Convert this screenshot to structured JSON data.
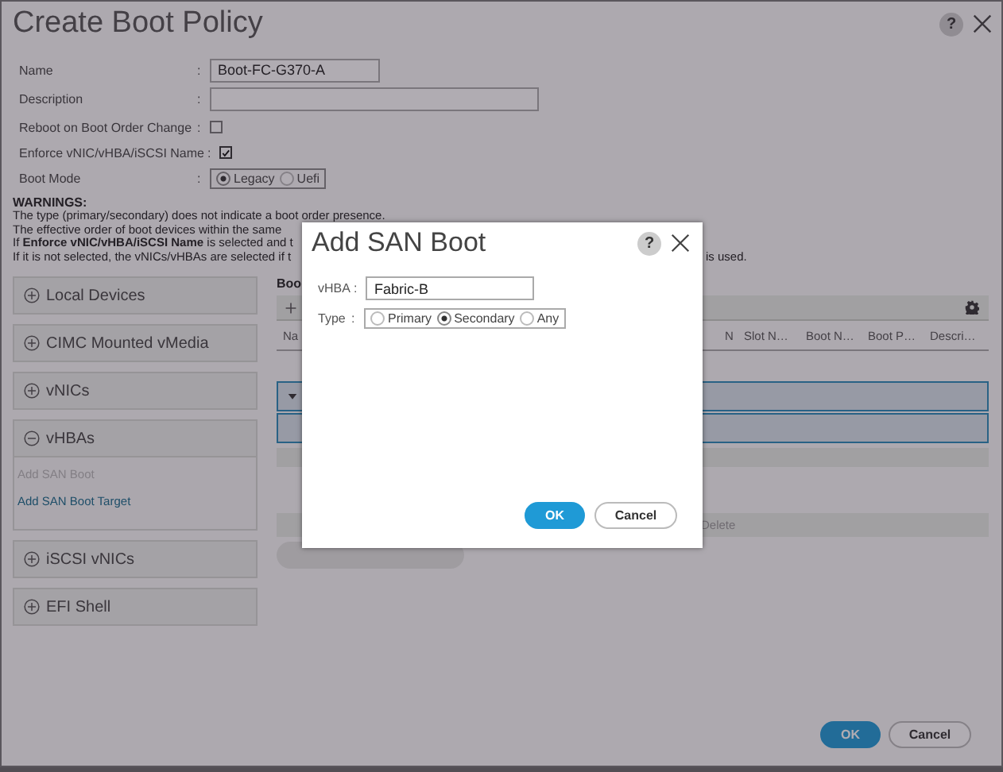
{
  "window": {
    "title": "Create Boot Policy",
    "help": "?"
  },
  "form": [
    {
      "kind": "text",
      "label": "Name",
      "colon": ":",
      "value": "Boot-FC-G370-A"
    },
    {
      "kind": "text",
      "label": "Description",
      "colon": ":"
    },
    {
      "kind": "checkbox",
      "label": "Reboot on Boot Order Change",
      "colon": ":",
      "checked": false
    },
    {
      "kind": "checkbox",
      "label": "Enforce vNIC/vHBA/iSCSI Name",
      "colon": ":",
      "checked": true
    },
    {
      "kind": "radio",
      "label": "Boot Mode",
      "colon": ":",
      "options": [
        {
          "label": "Legacy",
          "selected": true
        },
        {
          "label": "Uefi",
          "selected": false
        }
      ]
    }
  ],
  "warnings": {
    "title": "WARNINGS:",
    "lines": [
      {
        "parts": [
          "The type (primary/secondary) does not indicate a boot order presence."
        ]
      },
      {
        "parts": [
          "The effective order of boot devices within the same "
        ]
      },
      {
        "parts": [
          "If **Enforce vNIC/vHBA/iSCSI Name** is selected and t"
        ]
      },
      {
        "parts": [
          "If it is not selected, the vNICs/vHBAs are selected if t",
          "is used."
        ]
      }
    ]
  },
  "sections": [
    {
      "label": "Local Devices",
      "expanded": false
    },
    {
      "label": "CIMC Mounted vMedia",
      "expanded": false
    },
    {
      "label": "vNICs",
      "expanded": false
    },
    {
      "label": "vHBAs",
      "expanded": true,
      "items": [
        {
          "label": "Add SAN Boot",
          "disabled": true
        },
        {
          "label": "Add SAN Boot Target",
          "disabled": false
        }
      ]
    },
    {
      "label": "iSCSI vNICs",
      "expanded": false
    },
    {
      "label": "EFI Shell",
      "expanded": false
    }
  ],
  "boot_order": {
    "title": "Boo",
    "columns": [
      "Na",
      "N",
      "Slot N…",
      "Boot N…",
      "Boot P…",
      "Descri…"
    ],
    "actions": [
      "Delete"
    ]
  },
  "buttons": [
    {
      "label": "OK",
      "kind": "primary"
    },
    {
      "label": "Cancel",
      "kind": "secondary"
    }
  ],
  "modal": {
    "title": "Add SAN Boot",
    "help": "?",
    "fields": [
      {
        "kind": "text",
        "label": "vHBA",
        "colon": ":",
        "value": "Fabric-B"
      },
      {
        "kind": "radio",
        "label": "Type",
        "colon": ":",
        "options": [
          {
            "label": "Primary",
            "selected": false
          },
          {
            "label": "Secondary",
            "selected": true
          },
          {
            "label": "Any",
            "selected": false
          }
        ]
      }
    ],
    "buttons": [
      {
        "label": "OK",
        "kind": "primary"
      },
      {
        "label": "Cancel",
        "kind": "secondary"
      }
    ]
  }
}
